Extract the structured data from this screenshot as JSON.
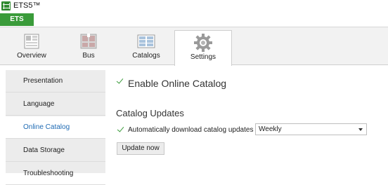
{
  "window": {
    "title": "ETS5™"
  },
  "app_tab": {
    "label": "ETS"
  },
  "ribbon": {
    "tabs": [
      {
        "label": "Overview",
        "icon": "overview-icon"
      },
      {
        "label": "Bus",
        "icon": "bus-icon"
      },
      {
        "label": "Catalogs",
        "icon": "catalogs-icon"
      },
      {
        "label": "Settings",
        "icon": "gear-icon",
        "active": true
      }
    ]
  },
  "sidebar": {
    "items": [
      {
        "label": "Presentation"
      },
      {
        "label": "Language"
      },
      {
        "label": "Online Catalog",
        "active": true
      },
      {
        "label": "Data Storage"
      },
      {
        "label": "Troubleshooting"
      }
    ]
  },
  "main": {
    "enable_label": "Enable Online Catalog",
    "enable_checked": true,
    "section_title": "Catalog Updates",
    "auto_label": "Automatically download catalog updates",
    "auto_checked": true,
    "frequency_value": "Weekly",
    "update_button": "Update now"
  },
  "colors": {
    "accent_green": "#3a9b3a",
    "active_blue": "#1f6bb4"
  }
}
